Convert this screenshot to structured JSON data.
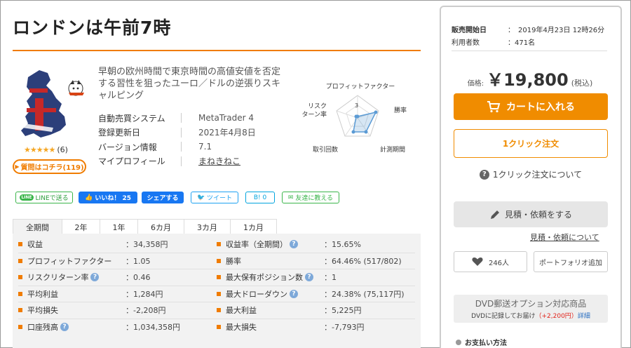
{
  "product": {
    "title": "ロンドンは午前7時",
    "description": "早朝の欧州時間で東京時間の高値安値を否定する習性を狙ったユーロ／ドルの逆張りスキャルピング",
    "rating_count": "(6)",
    "qa_label": "質問はコチラ(119)",
    "logo_text": "UK",
    "specs": [
      {
        "label": "自動売買システム",
        "value": "MetaTrader 4"
      },
      {
        "label": "登録更新日",
        "value": "2021年4月8日"
      },
      {
        "label": "バージョン情報",
        "value": "7.1"
      },
      {
        "label": "マイプロフィール",
        "value": "まねきねこ"
      }
    ]
  },
  "radar": {
    "title": "プロフィットファクター",
    "labels": {
      "top": "プロフィットファクター",
      "left": "リスク\nターン率",
      "right": "勝率",
      "bottom_left": "取引回数",
      "bottom_right": "計測期間"
    },
    "scale_label": "3",
    "color": "#5b9bd5"
  },
  "social": {
    "line": "LINEで送る",
    "line_icon": "LINE",
    "fb_like": "いいね！ 25",
    "fb_share": "シェアする",
    "tweet": "ツイート",
    "hatena": "B! 0",
    "friend": "友達に教える"
  },
  "tabs": [
    "全期間",
    "2年",
    "1年",
    "6カ月",
    "3カ月",
    "1カ月"
  ],
  "stats_left": [
    {
      "label": "収益",
      "value": "：34,358円",
      "help": false
    },
    {
      "label": "プロフィットファクター",
      "value": "：1.05",
      "help": false
    },
    {
      "label": "リスクリターン率",
      "value": "：0.46",
      "help": true
    },
    {
      "label": "平均利益",
      "value": "：1,284円",
      "help": false
    },
    {
      "label": "平均損失",
      "value": "：-2,208円",
      "help": false
    },
    {
      "label": "口座残高",
      "value": "：1,034,358円",
      "help": true
    }
  ],
  "stats_right": [
    {
      "label": "収益率（全期間）",
      "value": "：15.65%",
      "help": true
    },
    {
      "label": "勝率",
      "value": "：64.46% (517/802)",
      "help": false
    },
    {
      "label": "最大保有ポジション数",
      "value": "：1",
      "help": true
    },
    {
      "label": "最大ドローダウン",
      "value": "：24.38% (75,117円)",
      "help": true
    },
    {
      "label": "最大利益",
      "value": "：5,225円",
      "help": false
    },
    {
      "label": "最大損失",
      "value": "：-7,793円",
      "help": false
    }
  ],
  "sidebar": {
    "sale_start_label": "販売開始日",
    "sale_start_value": "：　2019年4月23日 12時26分",
    "users_label": "利用者数",
    "users_value": "：471名",
    "price_label": "価格:",
    "price_value": "￥19,800",
    "price_tax": "(税込)",
    "cart_label": "カートに入れる",
    "oneclick_label": "1クリック注文",
    "oneclick_about": "1クリック注文について",
    "quote_label": "見積・依頼をする",
    "quote_link": "見積・依頼について",
    "fav_count": "246人",
    "portfolio_label": "ポートフォリオ追加",
    "dvd_title": "DVD郵送オプション対応商品",
    "dvd_sub_prefix": "DVDに記録してお届け",
    "dvd_sub_price": "（+2,200円）",
    "dvd_sub_detail": "詳細",
    "payment_label": "お支払い方法"
  },
  "colors": {
    "accent": "#f07c00",
    "cart": "#f08c00",
    "facebook": "#1877f2",
    "line": "#3ab54a",
    "twitter": "#1da1f2"
  }
}
